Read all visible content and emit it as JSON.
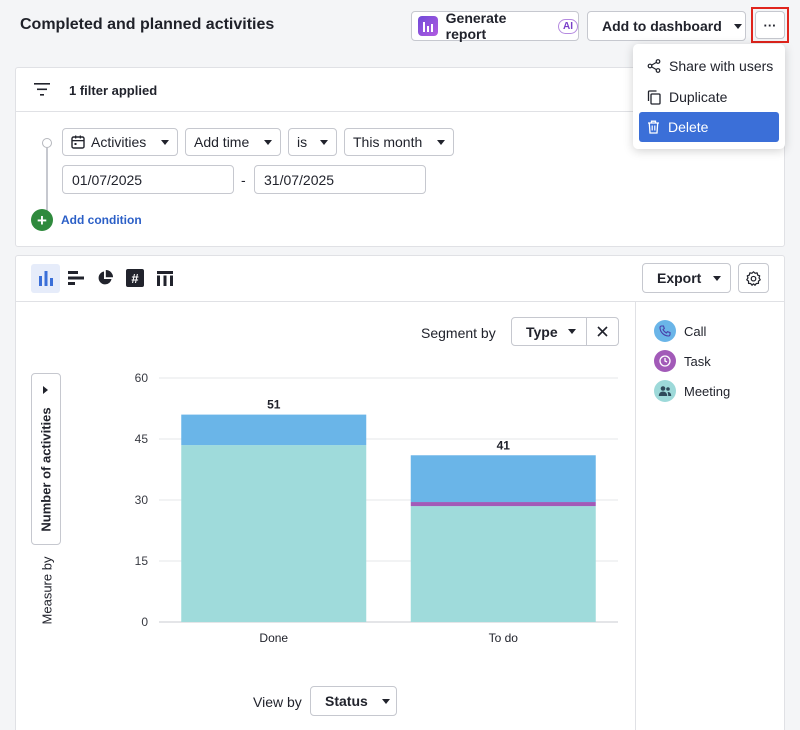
{
  "header": {
    "title": "Completed and planned activities",
    "generate_report": "Generate report",
    "ai_badge": "AI",
    "add_to_dashboard": "Add to dashboard",
    "more": "···"
  },
  "more_menu": {
    "items": [
      {
        "label": "Share with users",
        "icon": "share-icon"
      },
      {
        "label": "Duplicate",
        "icon": "duplicate-icon"
      },
      {
        "label": "Delete",
        "icon": "trash-icon",
        "selected": true
      }
    ]
  },
  "filters": {
    "summary": "1 filter applied",
    "entity": "Activities",
    "field": "Add time",
    "operator": "is",
    "period": "This month",
    "date_from": "01/07/2025",
    "date_separator": "-",
    "date_to": "31/07/2025",
    "add_condition": "Add condition"
  },
  "toolbar": {
    "export": "Export",
    "chart_types": [
      "bar-chart-icon",
      "horizontal-bar-icon",
      "pie-chart-icon",
      "number-icon",
      "table-icon"
    ]
  },
  "chart_controls": {
    "segment_by_label": "Segment by",
    "segment_by_value": "Type",
    "measure_by_label": "Measure by",
    "measure_by_value": "Number of activities",
    "view_by_label": "View by",
    "view_by_value": "Status"
  },
  "legend": [
    {
      "label": "Call",
      "color": "#6ab5e8",
      "icon": "phone-icon"
    },
    {
      "label": "Task",
      "color": "#a25ab8",
      "icon": "clock-icon"
    },
    {
      "label": "Meeting",
      "color": "#9dd9d9",
      "icon": "people-icon"
    }
  ],
  "chart_data": {
    "type": "bar",
    "stacked": true,
    "categories": [
      "Done",
      "To do"
    ],
    "series": [
      {
        "name": "Meeting",
        "color": "#9fdbdb",
        "values": [
          43.5,
          28.5
        ]
      },
      {
        "name": "Task",
        "color": "#a25ab8",
        "values": [
          0,
          1
        ]
      },
      {
        "name": "Call",
        "color": "#6ab5e8",
        "values": [
          7.5,
          11.5
        ]
      }
    ],
    "totals": [
      "51",
      "41"
    ],
    "yticks": [
      "0",
      "15",
      "30",
      "45",
      "60"
    ],
    "ylim": [
      0,
      60
    ],
    "grid": true
  },
  "colors": {
    "accent": "#3b6fd8",
    "highlight_box": "#e0241c",
    "add_green": "#2f8a3d"
  }
}
